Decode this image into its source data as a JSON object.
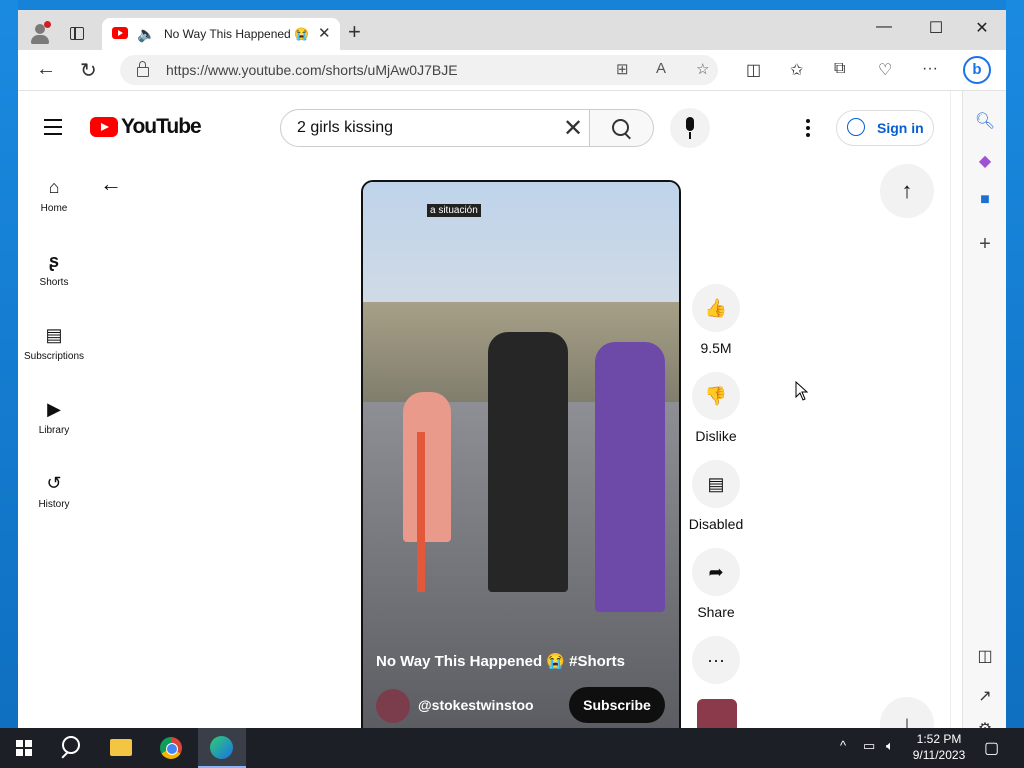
{
  "browser": {
    "tab_title": "No Way This Happened 😭",
    "url": "https://www.youtube.com/shorts/uMjAw0J7BJE"
  },
  "youtube": {
    "logo_text": "YouTube",
    "search_query": "2 girls kissing",
    "signin_label": "Sign in",
    "sidenav": [
      {
        "label": "Home",
        "icon": "home-icon"
      },
      {
        "label": "Shorts",
        "icon": "shorts-icon"
      },
      {
        "label": "Subscriptions",
        "icon": "subscriptions-icon"
      },
      {
        "label": "Library",
        "icon": "library-icon"
      },
      {
        "label": "History",
        "icon": "history-icon"
      }
    ]
  },
  "short": {
    "caption_overlay": "a situación",
    "title": "No Way This Happened 😭 #Shorts",
    "channel": "@stokestwinstoo",
    "subscribe_label": "Subscribe",
    "actions": {
      "like": "9.5M",
      "dislike": "Dislike",
      "comments": "Disabled",
      "share": "Share"
    }
  },
  "taskbar": {
    "time": "1:52 PM",
    "date": "9/11/2023"
  }
}
